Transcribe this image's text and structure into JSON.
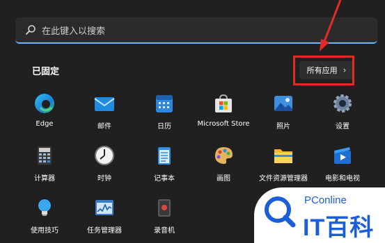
{
  "search": {
    "placeholder": "在此键入以搜索",
    "icon": "search-icon"
  },
  "pinned": {
    "title": "已固定",
    "all_apps_label": "所有应用",
    "all_apps_chevron": "›"
  },
  "apps": [
    {
      "name": "Edge",
      "icon": "edge-icon"
    },
    {
      "name": "邮件",
      "icon": "mail-icon"
    },
    {
      "name": "日历",
      "icon": "calendar-icon"
    },
    {
      "name": "Microsoft Store",
      "icon": "store-icon"
    },
    {
      "name": "照片",
      "icon": "photos-icon"
    },
    {
      "name": "设置",
      "icon": "settings-icon"
    },
    {
      "name": "计算器",
      "icon": "calculator-icon"
    },
    {
      "name": "时钟",
      "icon": "clock-icon"
    },
    {
      "name": "记事本",
      "icon": "notepad-icon"
    },
    {
      "name": "画图",
      "icon": "paint-icon"
    },
    {
      "name": "文件资源管理器",
      "icon": "folder-icon"
    },
    {
      "name": "电影和电视",
      "icon": "movies-icon"
    },
    {
      "name": "使用技巧",
      "icon": "tips-icon"
    },
    {
      "name": "任务管理器",
      "icon": "task-manager-icon"
    },
    {
      "name": "录音机",
      "icon": "recorder-icon"
    }
  ],
  "watermark": {
    "brand": "PConline",
    "text": "IT百科"
  },
  "colors": {
    "highlight": "#e22a27",
    "accent": "#6fb8ff",
    "watermark_blue": "#1c5dd8"
  }
}
